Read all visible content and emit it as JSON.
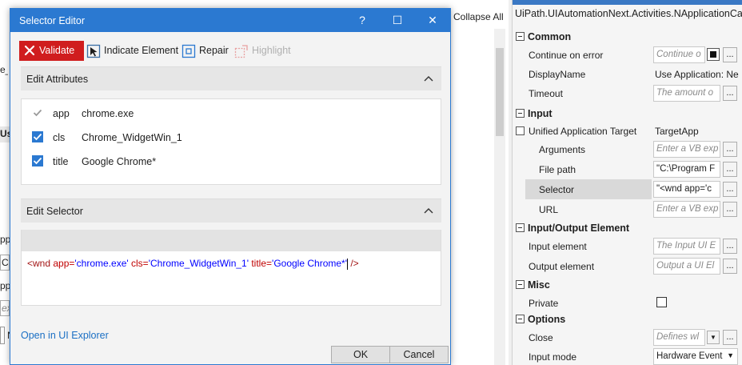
{
  "background": {
    "collapse_all": "Collapse All",
    "fragments": [
      "e_",
      "Us",
      "ppl",
      "C:\\",
      "ppl",
      "ex",
      "N"
    ]
  },
  "dialog": {
    "title": "Selector Editor",
    "title_buttons": [
      "?",
      "☐",
      "✕"
    ],
    "toolbar": {
      "validate": "Validate",
      "indicate": "Indicate Element",
      "repair": "Repair",
      "highlight": "Highlight"
    },
    "attributes_header": "Edit Attributes",
    "attributes": [
      {
        "name": "app",
        "value": "chrome.exe",
        "checked": true,
        "locked": true
      },
      {
        "name": "cls",
        "value": "Chrome_WidgetWin_1",
        "checked": true,
        "locked": false
      },
      {
        "name": "title",
        "value": "Google Chrome*",
        "checked": true,
        "locked": false
      }
    ],
    "selector_header": "Edit Selector",
    "selector": {
      "open": "<wnd ",
      "a1": "app=",
      "v1": "'chrome.exe'",
      "a2": "cls=",
      "v2": "'Chrome_WidgetWin_1'",
      "a3": "title=",
      "v3": "'Google Chrome*'",
      "close": " />"
    },
    "open_in_explorer": "Open in UI Explorer",
    "ok": "OK",
    "cancel": "Cancel"
  },
  "properties": {
    "title": "UiPath.UIAutomationNext.Activities.NApplicationCard",
    "categories": {
      "common": "Common",
      "input": "Input",
      "io_element": "Input/Output Element",
      "misc": "Misc",
      "options": "Options"
    },
    "rows": {
      "continue_on_error": {
        "name": "Continue on error",
        "value": "Continue o"
      },
      "display_name": {
        "name": "DisplayName",
        "value": "Use Application: Ne"
      },
      "timeout": {
        "name": "Timeout",
        "value": "The amount o"
      },
      "unified_target": {
        "name": "Unified Application Target",
        "value": "TargetApp"
      },
      "arguments": {
        "name": "Arguments",
        "value": "Enter a VB exp"
      },
      "file_path": {
        "name": "File path",
        "value": "\"C:\\Program F"
      },
      "selector": {
        "name": "Selector",
        "value": "\"<wnd app='c"
      },
      "url": {
        "name": "URL",
        "value": "Enter a VB exp"
      },
      "input_element": {
        "name": "Input element",
        "value": "The Input UI E"
      },
      "output_element": {
        "name": "Output element",
        "value": "Output a UI El"
      },
      "private": {
        "name": "Private",
        "value": ""
      },
      "close": {
        "name": "Close",
        "value": "Defines wl"
      },
      "input_mode": {
        "name": "Input mode",
        "value": "Hardware Event"
      }
    },
    "dots": "..."
  },
  "colors": {
    "accent": "#2b79d1",
    "validate_red": "#d01d1e",
    "link": "#1a6fc4"
  }
}
